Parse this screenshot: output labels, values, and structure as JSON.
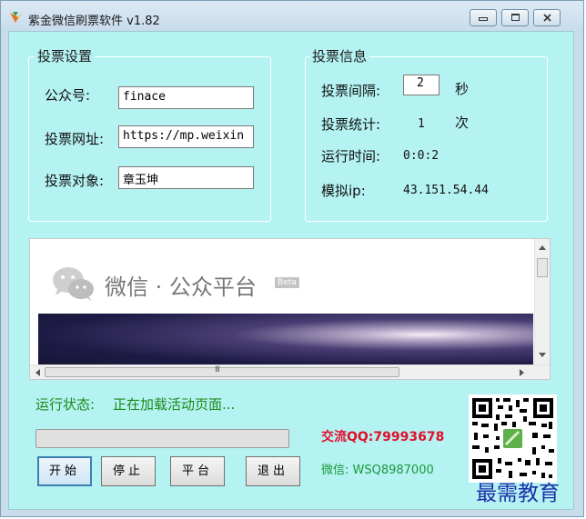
{
  "titlebar": {
    "title": "紫金微信刷票软件 v1.82",
    "minimize_icon": "minimize-icon",
    "maximize_icon": "maximize-icon",
    "close_icon": "close-icon"
  },
  "vote_settings": {
    "legend": "投票设置",
    "account_label": "公众号:",
    "account_value": "finace",
    "url_label": "投票网址:",
    "url_value": "https://mp.weixin",
    "target_label": "投票对象:",
    "target_value": "章玉坤"
  },
  "vote_info": {
    "legend": "投票信息",
    "interval_label": "投票间隔:",
    "interval_value": "2",
    "interval_unit": "秒",
    "stats_label": "投票统计:",
    "stats_value": "1",
    "stats_unit": "次",
    "runtime_label": "运行时间:",
    "runtime_value": "0:0:2",
    "ip_label": "模拟ip:",
    "ip_value": "43.151.54.44"
  },
  "browser": {
    "logo_text": "微信 · 公众平台",
    "beta_badge": "Beta",
    "hscroll_thumb_glyph": "III"
  },
  "status": {
    "label": "运行状态:",
    "text": "正在加载活动页面...",
    "progress": 0
  },
  "buttons": {
    "start": "开始",
    "stop": "停止",
    "platform": "平台",
    "exit": "退出"
  },
  "contact": {
    "qq": "交流QQ:79993678",
    "wechat": "微信: WSQ8987000"
  },
  "watermark": "最需教育",
  "colors": {
    "client_bg": "#b5f2f2",
    "status_green": "#1a8a1a",
    "qq_red": "#e0102a",
    "wechat_green": "#1a9a3a",
    "watermark_blue": "#1c2fa8"
  }
}
